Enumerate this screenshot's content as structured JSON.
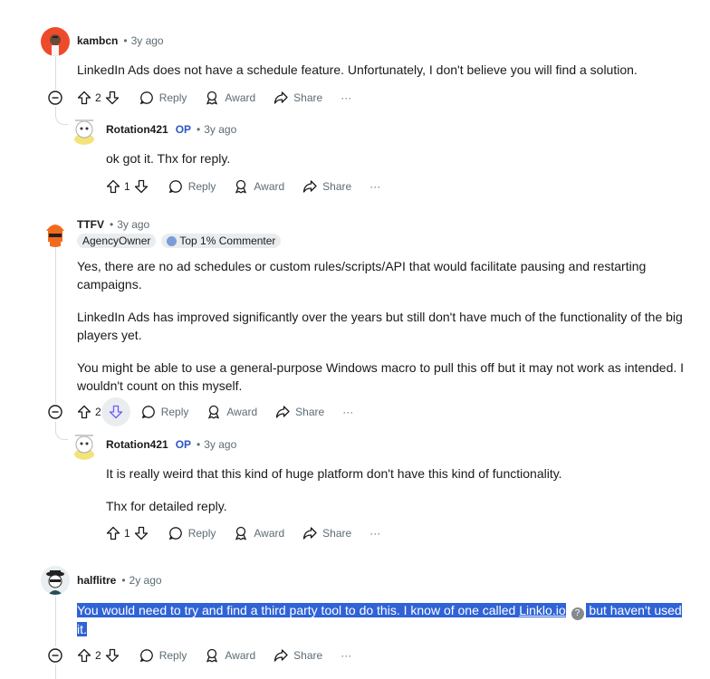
{
  "comments": [
    {
      "author": "kambcn",
      "time": "3y ago",
      "text": "LinkedIn Ads does not have a schedule feature. Unfortunately, I don't believe you will find a solution.",
      "votes": "2"
    },
    {
      "author": "Rotation421",
      "op": "OP",
      "time": "3y ago",
      "text": "ok got it. Thx for reply.",
      "votes": "1"
    },
    {
      "author": "TTFV",
      "time": "3y ago",
      "flairs": [
        "AgencyOwner",
        "Top 1% Commenter"
      ],
      "paragraphs": [
        "Yes, there are no ad schedules or custom rules/scripts/API that would facilitate pausing and restarting campaigns.",
        "LinkedIn Ads has improved significantly over the years but still don't have much of the functionality of the big players yet.",
        "You might be able to use a general-purpose Windows macro to pull this off but it may not work as intended. I wouldn't count on this myself."
      ],
      "votes": "2"
    },
    {
      "author": "Rotation421",
      "op": "OP",
      "time": "3y ago",
      "paragraphs": [
        "It is really weird that this kind of huge platform don't have this kind of functionality.",
        "Thx for detailed reply."
      ],
      "votes": "1"
    },
    {
      "author": "halflitre",
      "time": "2y ago",
      "text_before": "You would need to try and find a third party tool to do this. I know of one called ",
      "link": "Linklo.io",
      "help": "?",
      "text_after_1": " but haven't used",
      "text_after_2": "it.",
      "votes": "2"
    }
  ],
  "labels": {
    "reply": "Reply",
    "award": "Award",
    "share": "Share",
    "more": "···",
    "dot": "•"
  }
}
